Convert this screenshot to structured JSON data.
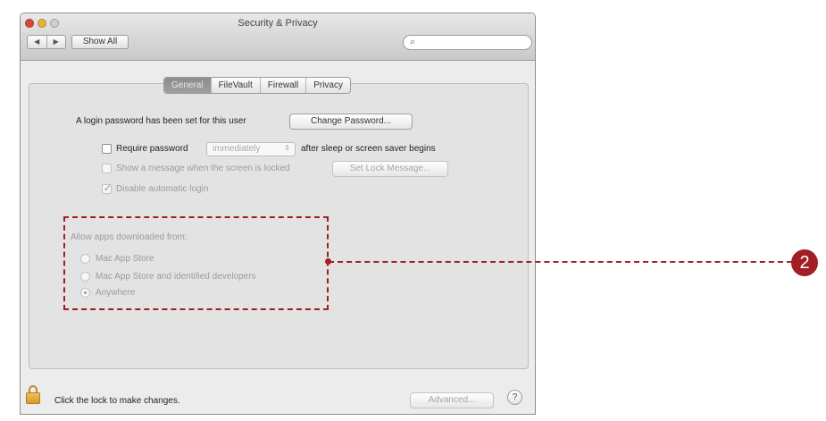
{
  "window": {
    "title": "Security & Privacy"
  },
  "toolbar": {
    "back": "◀",
    "forward": "▶",
    "show_all": "Show All",
    "search_icon": "magnifier-icon"
  },
  "tabs": [
    {
      "label": "General",
      "active": true
    },
    {
      "label": "FileVault",
      "active": false
    },
    {
      "label": "Firewall",
      "active": false
    },
    {
      "label": "Privacy",
      "active": false
    }
  ],
  "general": {
    "login_text": "A login password has been set for this user",
    "change_password": "Change Password...",
    "require_password": {
      "label": "Require password",
      "checked": false,
      "select_value": "immediately",
      "suffix": "after sleep or screen saver begins"
    },
    "show_message": {
      "label": "Show a message when the screen is locked",
      "checked": false,
      "button": "Set Lock Message..."
    },
    "disable_login": {
      "label": "Disable automatic login",
      "checked": true
    },
    "allow_heading": "Allow apps downloaded from:",
    "allow_options": [
      {
        "label": "Mac App Store",
        "selected": false
      },
      {
        "label": "Mac App Store and identified developers",
        "selected": false
      },
      {
        "label": "Anywhere",
        "selected": true
      }
    ]
  },
  "footer": {
    "lock_text": "Click the lock to make changes.",
    "advanced": "Advanced...",
    "help": "?"
  },
  "callout": {
    "number": "2",
    "color": "#a11f24"
  }
}
